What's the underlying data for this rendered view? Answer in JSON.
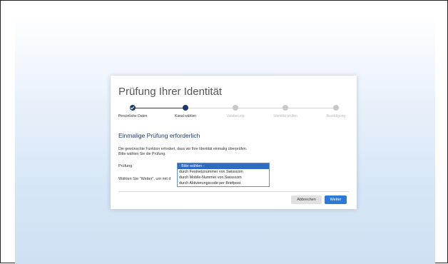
{
  "dialog": {
    "title": "Prüfung Ihrer Identität",
    "steps": [
      {
        "label": "Persönliche Daten",
        "state": "done"
      },
      {
        "label": "Kanal wählen",
        "state": "active"
      },
      {
        "label": "Validierung",
        "state": "pending"
      },
      {
        "label": "Identität prüfen",
        "state": "pending"
      },
      {
        "label": "Bestätigung",
        "state": "pending"
      }
    ],
    "heading": "Einmalige Prüfung erforderlich",
    "description_line1": "Die gewünschte Funktion erfordert, dass wir Ihre Identität einmalig überprüfen.",
    "description_line2": "Bitte wählen Sie die Prüfung.",
    "field_label": "Prüfung",
    "hint": "Wählen Sie \"Weiter\", um mit d",
    "select": {
      "options": [
        "- Bitte wählen -",
        "durch Festnetznummer von Swisscom",
        "durch Mobile-Nummer von Swisscom",
        "durch Aktivierungscode per Briefpost"
      ],
      "selected_index": 0
    },
    "buttons": {
      "cancel": "Abbrechen",
      "next": "Weiter"
    }
  },
  "colors": {
    "accent": "#1b3a6b",
    "primary_button": "#2d7ad6",
    "selected_option": "#2d6cc0",
    "backdrop": "#d6e6f6"
  }
}
